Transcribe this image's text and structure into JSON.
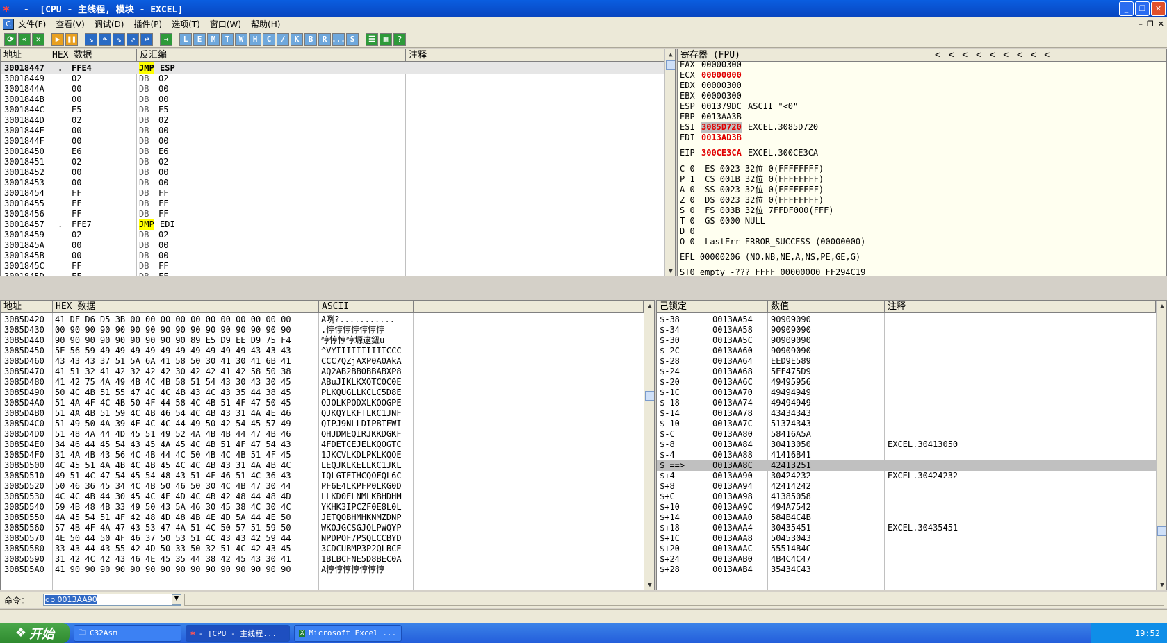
{
  "window": {
    "title": " -  [CPU - 主线程, 模块 - EXCEL]"
  },
  "menu": [
    "文件(F)",
    "查看(V)",
    "调试(D)",
    "插件(P)",
    "选项(T)",
    "窗口(W)",
    "帮助(H)"
  ],
  "toolbar": [
    "L",
    "E",
    "M",
    "T",
    "W",
    "H",
    "C",
    "/",
    "K",
    "B",
    "R",
    "...",
    "S"
  ],
  "disasm": {
    "headers": [
      "地址",
      "HEX 数据",
      "反汇编",
      "注释"
    ],
    "rows": [
      {
        "addr": "30018447",
        "mark": ".",
        "hex": "FFE4",
        "op": "JMP",
        "arg": "ESP"
      },
      {
        "addr": "30018449",
        "mark": "",
        "hex": "02",
        "op": "DB",
        "arg": "02"
      },
      {
        "addr": "3001844A",
        "mark": "",
        "hex": "00",
        "op": "DB",
        "arg": "00"
      },
      {
        "addr": "3001844B",
        "mark": "",
        "hex": "00",
        "op": "DB",
        "arg": "00"
      },
      {
        "addr": "3001844C",
        "mark": "",
        "hex": "E5",
        "op": "DB",
        "arg": "E5"
      },
      {
        "addr": "3001844D",
        "mark": "",
        "hex": "02",
        "op": "DB",
        "arg": "02"
      },
      {
        "addr": "3001844E",
        "mark": "",
        "hex": "00",
        "op": "DB",
        "arg": "00"
      },
      {
        "addr": "3001844F",
        "mark": "",
        "hex": "00",
        "op": "DB",
        "arg": "00"
      },
      {
        "addr": "30018450",
        "mark": "",
        "hex": "E6",
        "op": "DB",
        "arg": "E6"
      },
      {
        "addr": "30018451",
        "mark": "",
        "hex": "02",
        "op": "DB",
        "arg": "02"
      },
      {
        "addr": "30018452",
        "mark": "",
        "hex": "00",
        "op": "DB",
        "arg": "00"
      },
      {
        "addr": "30018453",
        "mark": "",
        "hex": "00",
        "op": "DB",
        "arg": "00"
      },
      {
        "addr": "30018454",
        "mark": "",
        "hex": "FF",
        "op": "DB",
        "arg": "FF"
      },
      {
        "addr": "30018455",
        "mark": "",
        "hex": "FF",
        "op": "DB",
        "arg": "FF"
      },
      {
        "addr": "30018456",
        "mark": "",
        "hex": "FF",
        "op": "DB",
        "arg": "FF"
      },
      {
        "addr": "30018457",
        "mark": ".",
        "hex": "FFE7",
        "op": "JMP",
        "arg": "EDI"
      },
      {
        "addr": "30018459",
        "mark": "",
        "hex": "02",
        "op": "DB",
        "arg": "02"
      },
      {
        "addr": "3001845A",
        "mark": "",
        "hex": "00",
        "op": "DB",
        "arg": "00"
      },
      {
        "addr": "3001845B",
        "mark": "",
        "hex": "00",
        "op": "DB",
        "arg": "00"
      },
      {
        "addr": "3001845C",
        "mark": "",
        "hex": "FF",
        "op": "DB",
        "arg": "FF"
      },
      {
        "addr": "3001845D",
        "mark": "",
        "hex": "FF",
        "op": "DB",
        "arg": "FF"
      }
    ]
  },
  "registers": {
    "title": "寄存器 (FPU)",
    "arrows": "<  <  <  <  <  <  <  <  <",
    "gp": [
      {
        "name": "EAX",
        "val": "00000300",
        "extra": "",
        "red": false
      },
      {
        "name": "ECX",
        "val": "00000000",
        "extra": "",
        "red": true
      },
      {
        "name": "EDX",
        "val": "00000300",
        "extra": "",
        "red": false
      },
      {
        "name": "EBX",
        "val": "00000300",
        "extra": "",
        "red": false
      },
      {
        "name": "ESP",
        "val": "001379DC",
        "extra": "ASCII \"<0\"",
        "red": false
      },
      {
        "name": "EBP",
        "val": "0013AA3B",
        "extra": "",
        "red": false
      },
      {
        "name": "ESI",
        "val": "3085D720",
        "extra": "EXCEL.3085D720",
        "red": true
      },
      {
        "name": "EDI",
        "val": "0013AD3B",
        "extra": "",
        "red": true
      }
    ],
    "eip": {
      "name": "EIP",
      "val": "300CE3CA",
      "extra": "EXCEL.300CE3CA"
    },
    "flags": [
      "C 0  ES 0023 32位 0(FFFFFFFF)",
      "P 1  CS 001B 32位 0(FFFFFFFF)",
      "A 0  SS 0023 32位 0(FFFFFFFF)",
      "Z 0  DS 0023 32位 0(FFFFFFFF)",
      "S 0  FS 003B 32位 7FFDF000(FFF)",
      "T 0  GS 0000 NULL",
      "D 0",
      "O 0  LastErr ERROR_SUCCESS (00000000)"
    ],
    "efl": "EFL 00000206 (NO,NB,NE,A,NS,PE,GE,G)",
    "st0": "ST0 empty -??? FFFF 00000000 FF294C19"
  },
  "dump": {
    "headers": [
      "地址",
      "HEX 数据",
      "ASCII"
    ],
    "rows": [
      [
        "3085D420",
        "41 DF D6 D5 3B 00 00 00 00 00 00 00 00 00 00 00",
        "A咧?..........."
      ],
      [
        "3085D430",
        "00 90 90 90 90 90 90 90 90 90 90 90 90 90 90 90",
        ".悙悙悙悙悙悙悙"
      ],
      [
        "3085D440",
        "90 90 90 90 90 90 90 90 90 89 E5 D9 EE D9 75 F4",
        "悙悙悙悙塬逮鈕u"
      ],
      [
        "3085D450",
        "5E 56 59 49 49 49 49 49 49 49 49 49 49 43 43 43",
        "^VYIIIIIIIIIICCC"
      ],
      [
        "3085D460",
        "43 43 43 37 51 5A 6A 41 58 50 30 41 30 41 6B 41",
        "CCC7QZjAXP0A0AkA"
      ],
      [
        "3085D470",
        "41 51 32 41 42 32 42 42 30 42 42 41 42 58 50 38",
        "AQ2AB2BB0BBABXP8"
      ],
      [
        "3085D480",
        "41 42 75 4A 49 4B 4C 4B 58 51 54 43 30 43 30 45",
        "ABuJIKLKXQTC0C0E"
      ],
      [
        "3085D490",
        "50 4C 4B 51 55 47 4C 4C 4B 43 4C 43 35 44 38 45",
        "PLKQUGLLKCLC5D8E"
      ],
      [
        "3085D4A0",
        "51 4A 4F 4C 4B 50 4F 44 58 4C 4B 51 4F 47 50 45",
        "QJOLKPODXLKQOGPE"
      ],
      [
        "3085D4B0",
        "51 4A 4B 51 59 4C 4B 46 54 4C 4B 43 31 4A 4E 46",
        "QJKQYLKFTLKC1JNF"
      ],
      [
        "3085D4C0",
        "51 49 50 4A 39 4E 4C 4C 44 49 50 42 54 45 57 49",
        "QIPJ9NLLDIPBTEWI"
      ],
      [
        "3085D4D0",
        "51 48 4A 44 4D 45 51 49 52 4A 4B 4B 44 47 4B 46",
        "QHJDMEQIRJKKDGKF"
      ],
      [
        "3085D4E0",
        "34 46 44 45 54 43 45 4A 45 4C 4B 51 4F 47 54 43",
        "4FDETCEJELKQOGTC"
      ],
      [
        "3085D4F0",
        "31 4A 4B 43 56 4C 4B 44 4C 50 4B 4C 4B 51 4F 45",
        "1JKCVLKDLPKLKQOE"
      ],
      [
        "3085D500",
        "4C 45 51 4A 4B 4C 4B 45 4C 4C 4B 43 31 4A 4B 4C",
        "LEQJKLKELLKC1JKL"
      ],
      [
        "3085D510",
        "49 51 4C 47 54 45 54 48 43 51 4F 46 51 4C 36 43",
        "IQLGTETHCQOFQL6C"
      ],
      [
        "3085D520",
        "50 46 36 45 34 4C 4B 50 46 50 30 4C 4B 47 30 44",
        "PF6E4LKPFP0LKG0D"
      ],
      [
        "3085D530",
        "4C 4C 4B 44 30 45 4C 4E 4D 4C 4B 42 48 44 48 4D",
        "LLKD0ELNMLKBHDHM"
      ],
      [
        "3085D540",
        "59 4B 48 4B 33 49 50 43 5A 46 30 45 38 4C 30 4C",
        "YKHK3IPCZF0E8L0L"
      ],
      [
        "3085D550",
        "4A 45 54 51 4F 42 48 4D 48 4B 4E 4D 5A 44 4E 50",
        "JETQOBHMHKNMZDNP"
      ],
      [
        "3085D560",
        "57 4B 4F 4A 47 43 53 47 4A 51 4C 50 57 51 59 50",
        "WKOJGCSGJQLPWQYP"
      ],
      [
        "3085D570",
        "4E 50 44 50 4F 46 37 50 53 51 4C 43 43 42 59 44",
        "NPDPOF7PSQLCCBYD"
      ],
      [
        "3085D580",
        "33 43 44 43 55 42 4D 50 33 50 32 51 4C 42 43 45",
        "3CDCUBMP3P2QLBCE"
      ],
      [
        "3085D590",
        "31 42 4C 42 43 46 4E 45 35 44 38 42 45 43 30 41",
        "1BLBCFNE5D8BEC0A"
      ],
      [
        "3085D5A0",
        "41 90 90 90 90 90 90 90 90 90 90 90 90 90 90 90",
        "A悙悙悙悙悙悙悙"
      ]
    ]
  },
  "stack": {
    "headers": [
      "己锁定",
      "数值",
      "注释"
    ],
    "rows": [
      [
        "$-38",
        "0013AA54",
        "90909090",
        ""
      ],
      [
        "$-34",
        "0013AA58",
        "90909090",
        ""
      ],
      [
        "$-30",
        "0013AA5C",
        "90909090",
        ""
      ],
      [
        "$-2C",
        "0013AA60",
        "90909090",
        ""
      ],
      [
        "$-28",
        "0013AA64",
        "EED9E589",
        ""
      ],
      [
        "$-24",
        "0013AA68",
        "5EF475D9",
        ""
      ],
      [
        "$-20",
        "0013AA6C",
        "49495956",
        ""
      ],
      [
        "$-1C",
        "0013AA70",
        "49494949",
        ""
      ],
      [
        "$-18",
        "0013AA74",
        "49494949",
        ""
      ],
      [
        "$-14",
        "0013AA78",
        "43434343",
        ""
      ],
      [
        "$-10",
        "0013AA7C",
        "51374343",
        ""
      ],
      [
        "$-C",
        "0013AA80",
        "58416A5A",
        ""
      ],
      [
        "$-8",
        "0013AA84",
        "30413050",
        "EXCEL.30413050"
      ],
      [
        "$-4",
        "0013AA88",
        "41416B41",
        ""
      ],
      [
        "$ ==>",
        "0013AA8C",
        "42413251",
        ""
      ],
      [
        "$+4",
        "0013AA90",
        "30424232",
        "EXCEL.30424232"
      ],
      [
        "$+8",
        "0013AA94",
        "42414242",
        ""
      ],
      [
        "$+C",
        "0013AA98",
        "41385058",
        ""
      ],
      [
        "$+10",
        "0013AA9C",
        "494A7542",
        ""
      ],
      [
        "$+14",
        "0013AAA0",
        "584B4C4B",
        ""
      ],
      [
        "$+18",
        "0013AAA4",
        "30435451",
        "EXCEL.30435451"
      ],
      [
        "$+1C",
        "0013AAA8",
        "50453043",
        ""
      ],
      [
        "$+20",
        "0013AAAC",
        "55514B4C",
        ""
      ],
      [
        "$+24",
        "0013AAB0",
        "4B4C4C47",
        ""
      ],
      [
        "$+28",
        "0013AAB4",
        "35434C43",
        ""
      ]
    ]
  },
  "command": {
    "label": "命令：",
    "value": "db 0013AA90"
  },
  "taskbar": {
    "start": "开始",
    "tasks": [
      "C32Asm",
      "- [CPU - 主线程...",
      "Microsoft Excel ..."
    ],
    "clock": "19:52"
  }
}
